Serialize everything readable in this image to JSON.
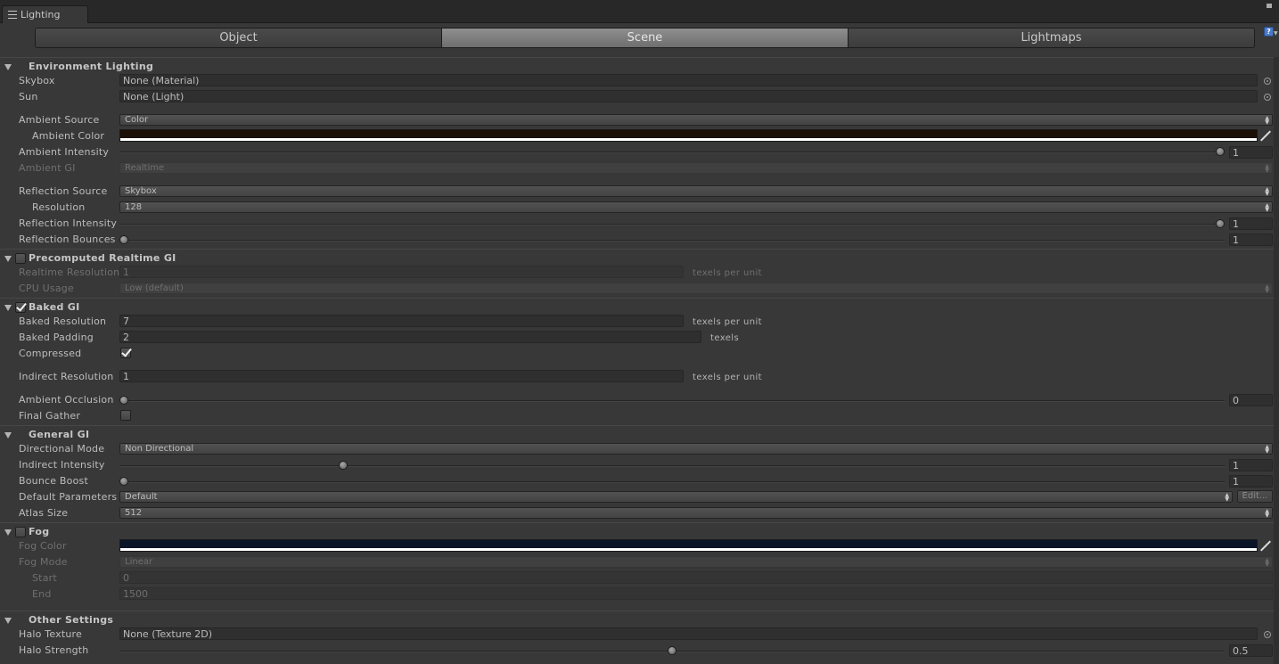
{
  "window": {
    "tab_title": "Lighting",
    "tab_icon": "list-icon"
  },
  "toolbar": {
    "tabs": [
      "Object",
      "Scene",
      "Lightmaps"
    ],
    "active_tab": "Scene",
    "help_icon": "?"
  },
  "environment": {
    "title": "Environment Lighting",
    "skybox_label": "Skybox",
    "skybox_value": "None (Material)",
    "sun_label": "Sun",
    "sun_value": "None (Light)",
    "ambient_source_label": "Ambient Source",
    "ambient_source_value": "Color",
    "ambient_color_label": "Ambient Color",
    "ambient_color": "#1c0f05",
    "ambient_intensity_label": "Ambient Intensity",
    "ambient_intensity_value": "1",
    "ambient_intensity_level": 1.0,
    "ambient_gi_label": "Ambient GI",
    "ambient_gi_value": "Realtime",
    "reflection_source_label": "Reflection Source",
    "reflection_source_value": "Skybox",
    "resolution_label": "Resolution",
    "resolution_value": "128",
    "reflection_intensity_label": "Reflection Intensity",
    "reflection_intensity_value": "1",
    "reflection_intensity_level": 1.0,
    "reflection_bounces_label": "Reflection Bounces",
    "reflection_bounces_value": "1",
    "reflection_bounces_level": 0.0
  },
  "precomputed": {
    "title": "Precomputed Realtime GI",
    "enabled": false,
    "realtime_resolution_label": "Realtime Resolution",
    "realtime_resolution_value": "1",
    "realtime_resolution_unit": "texels per unit",
    "cpu_usage_label": "CPU Usage",
    "cpu_usage_value": "Low (default)"
  },
  "baked": {
    "title": "Baked GI",
    "enabled": true,
    "baked_resolution_label": "Baked Resolution",
    "baked_resolution_value": "7",
    "baked_resolution_unit": "texels per unit",
    "baked_padding_label": "Baked Padding",
    "baked_padding_value": "2",
    "baked_padding_unit": "texels",
    "compressed_label": "Compressed",
    "compressed": true,
    "indirect_resolution_label": "Indirect Resolution",
    "indirect_resolution_value": "1",
    "indirect_resolution_unit": "texels per unit",
    "ambient_occlusion_label": "Ambient Occlusion",
    "ambient_occlusion_value": "0",
    "ambient_occlusion_level": 0.0,
    "final_gather_label": "Final Gather",
    "final_gather": false
  },
  "general": {
    "title": "General GI",
    "directional_mode_label": "Directional Mode",
    "directional_mode_value": "Non Directional",
    "indirect_intensity_label": "Indirect Intensity",
    "indirect_intensity_value": "1",
    "indirect_intensity_level": 0.2,
    "bounce_boost_label": "Bounce Boost",
    "bounce_boost_value": "1",
    "bounce_boost_level": 0.0,
    "default_parameters_label": "Default Parameters",
    "default_parameters_value": "Default",
    "edit_label": "Edit...",
    "atlas_size_label": "Atlas Size",
    "atlas_size_value": "512"
  },
  "fog": {
    "title": "Fog",
    "enabled": false,
    "fog_color_label": "Fog Color",
    "fog_color": "#0a1428",
    "fog_mode_label": "Fog Mode",
    "fog_mode_value": "Linear",
    "start_label": "Start",
    "start_value": "0",
    "end_label": "End",
    "end_value": "1500"
  },
  "other": {
    "title": "Other Settings",
    "halo_texture_label": "Halo Texture",
    "halo_texture_value": "None (Texture 2D)",
    "halo_strength_label": "Halo Strength",
    "halo_strength_value": "0.5",
    "halo_strength_level": 0.5
  }
}
